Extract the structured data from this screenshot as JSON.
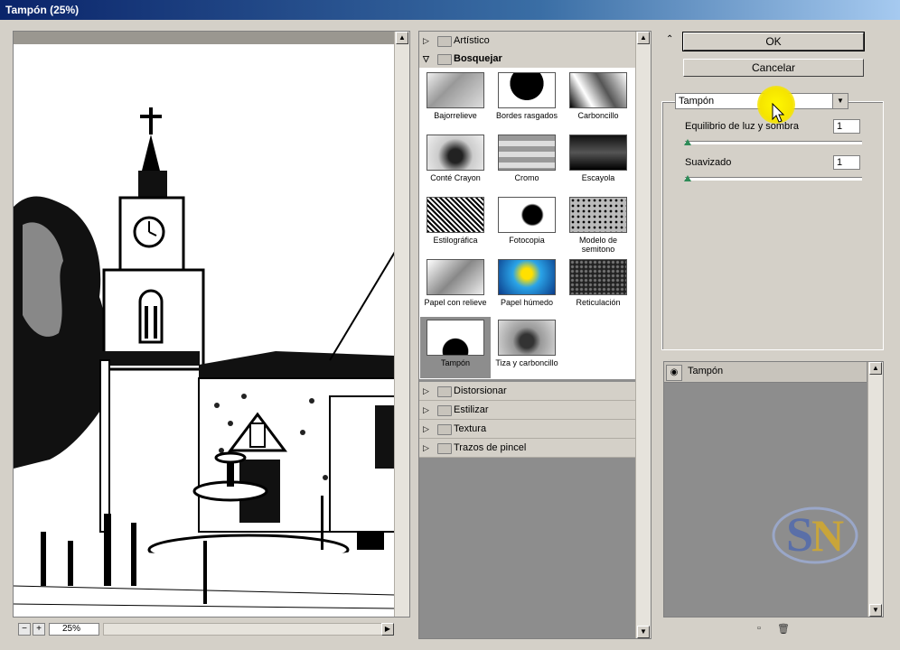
{
  "window": {
    "title": "Tampón (25%)"
  },
  "preview": {
    "zoom": "25%",
    "zoom_out": "−",
    "zoom_in": "+"
  },
  "filters": {
    "folders_top": [
      {
        "label": "Artístico",
        "expanded": false
      },
      {
        "label": "Bosquejar",
        "expanded": true
      }
    ],
    "thumbnails": [
      {
        "label": "Bajorrelieve"
      },
      {
        "label": "Bordes rasgados"
      },
      {
        "label": "Carboncillo"
      },
      {
        "label": "Conté Crayon"
      },
      {
        "label": "Cromo"
      },
      {
        "label": "Escayola"
      },
      {
        "label": "Estilográfica"
      },
      {
        "label": "Fotocopia"
      },
      {
        "label": "Modelo de semitono"
      },
      {
        "label": "Papel con relieve"
      },
      {
        "label": "Papel húmedo"
      },
      {
        "label": "Reticulación"
      },
      {
        "label": "Tampón",
        "selected": true
      },
      {
        "label": "Tiza y carboncillo"
      }
    ],
    "folders_bottom": [
      {
        "label": "Distorsionar"
      },
      {
        "label": "Estilizar"
      },
      {
        "label": "Textura"
      },
      {
        "label": "Trazos de pincel"
      }
    ]
  },
  "buttons": {
    "ok": "OK",
    "cancel": "Cancelar"
  },
  "settings": {
    "filter_select": "Tampón",
    "params": [
      {
        "label": "Equilibrio de luz y sombra",
        "value": "1"
      },
      {
        "label": "Suavizado",
        "value": "1"
      }
    ]
  },
  "layers": {
    "items": [
      {
        "label": "Tampón"
      }
    ]
  },
  "colors": {
    "accent_cursor": "#f5e400",
    "title_bar": "#0a246a"
  }
}
